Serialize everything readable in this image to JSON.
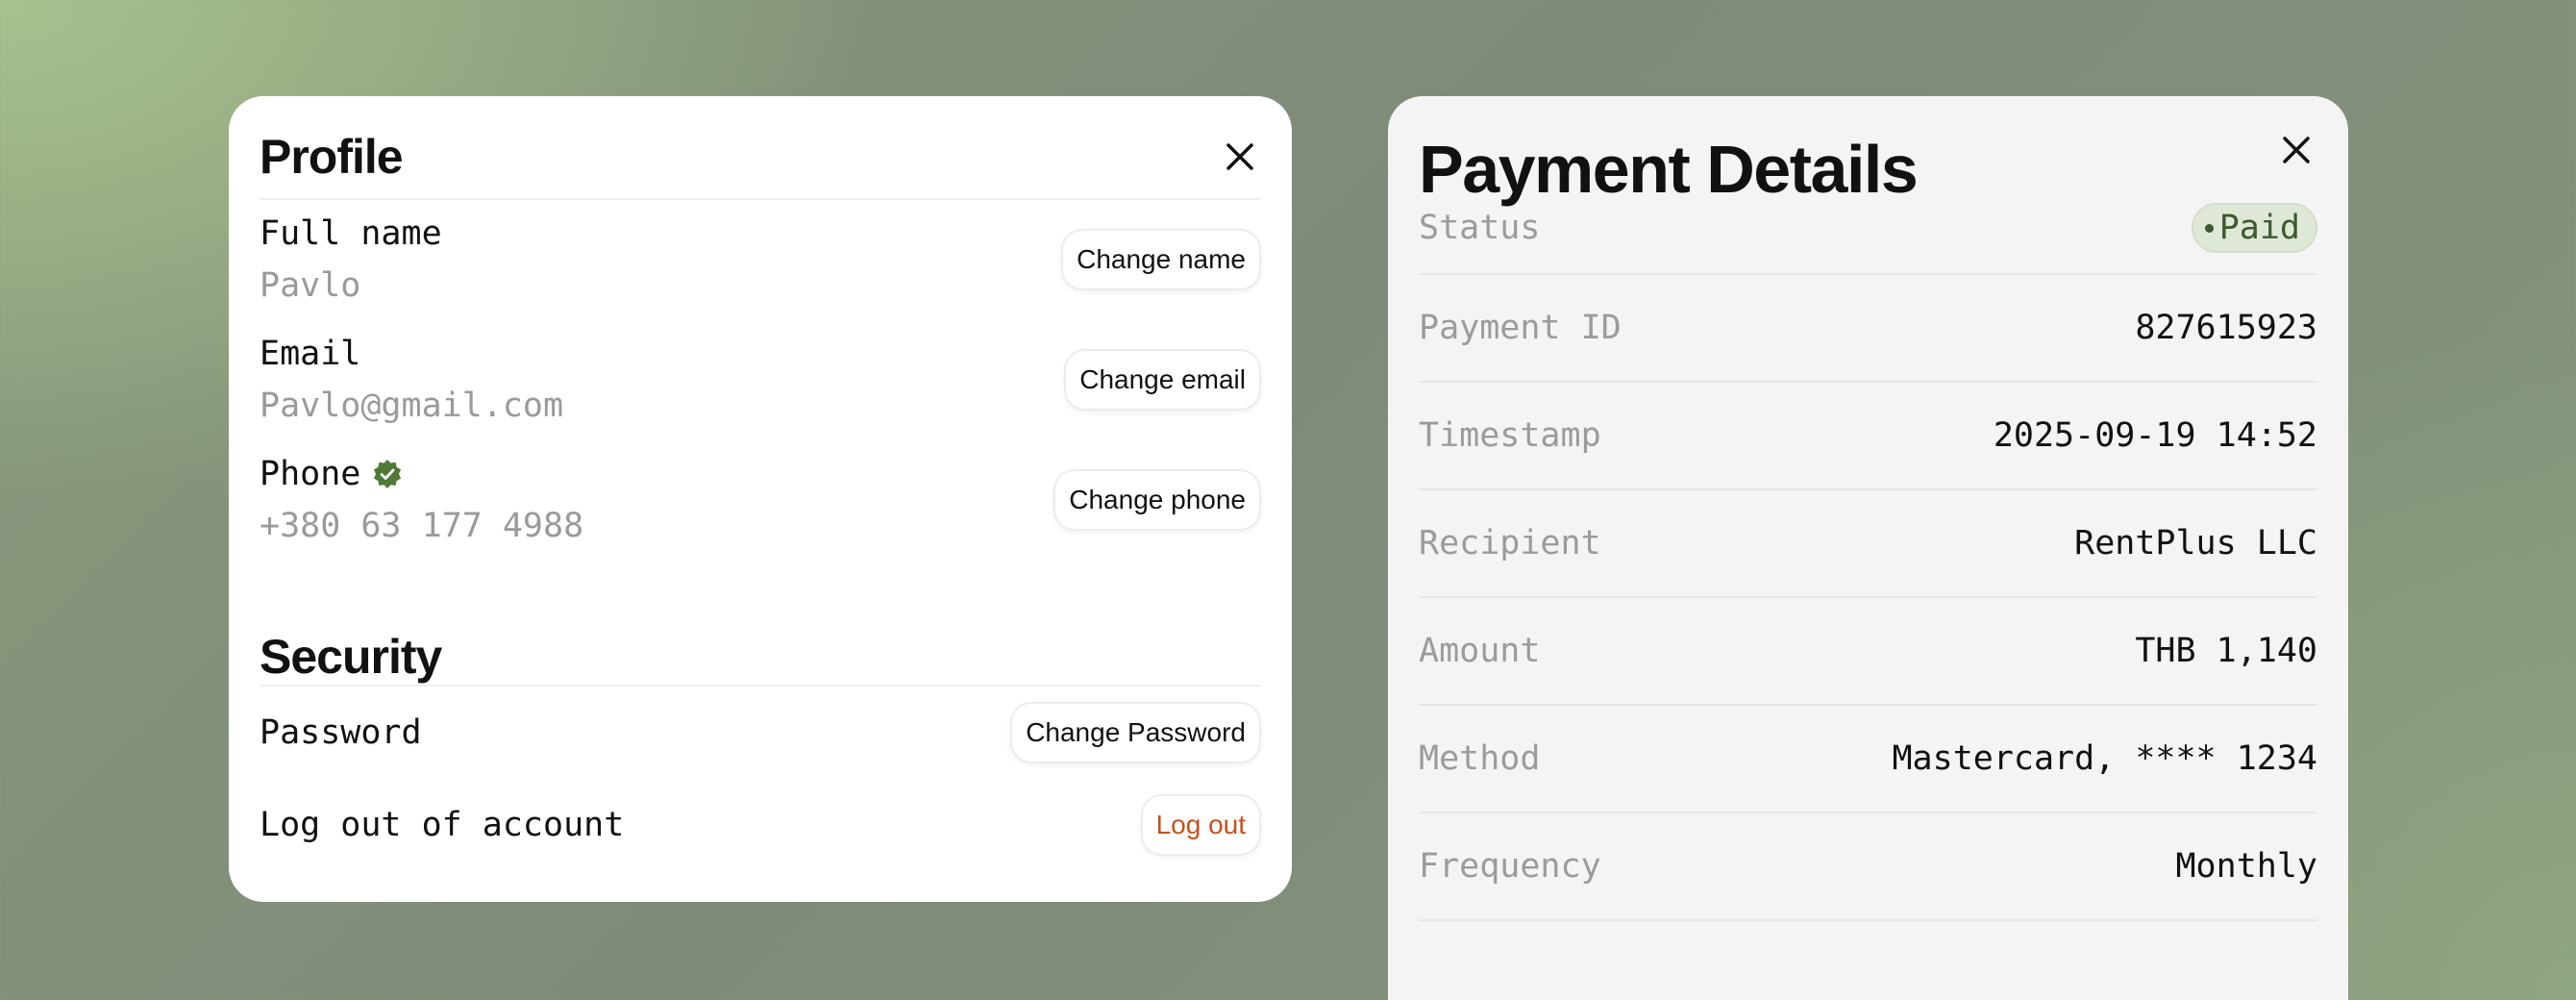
{
  "profile": {
    "title": "Profile",
    "fields": [
      {
        "label": "Full name",
        "value": "Pavlo",
        "button": "Change name"
      },
      {
        "label": "Email",
        "value": "Pavlo@gmail.com",
        "button": "Change email"
      },
      {
        "label": "Phone",
        "value": "+380 63 177 4988",
        "button": "Change phone",
        "verified": true
      }
    ]
  },
  "security": {
    "title": "Security",
    "password_label": "Password",
    "password_button": "Change Password",
    "logout_label": "Log out of account",
    "logout_button": "Log out"
  },
  "payment": {
    "title": "Payment Details",
    "status_label": "Status",
    "status_value": "Paid",
    "rows": [
      {
        "label": "Payment ID",
        "value": "827615923"
      },
      {
        "label": "Timestamp",
        "value": "2025-09-19 14:52"
      },
      {
        "label": "Recipient",
        "value": "RentPlus LLC"
      },
      {
        "label": "Amount",
        "value": "THB 1,140"
      },
      {
        "label": "Method",
        "value": "Mastercard, **** 1234"
      },
      {
        "label": "Frequency",
        "value": "Monthly"
      }
    ]
  },
  "colors": {
    "verified": "#4f7a35",
    "danger": "#c8501c",
    "status_bg": "#dfe8d6",
    "status_text": "#3c5a2e"
  },
  "icons": {
    "close": "close-icon",
    "verified": "verified-badge-icon"
  }
}
